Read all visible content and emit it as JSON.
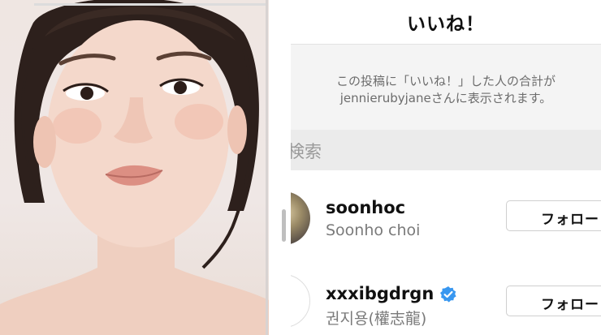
{
  "header": {
    "title": "いいね！"
  },
  "notice": {
    "line1": "この投稿に「いいね！」した人の合計が",
    "line2": "jennierubyjaneさんに表示されます。"
  },
  "search": {
    "placeholder": "検索"
  },
  "likers": [
    {
      "username": "soonhoc",
      "full_name": "Soonho choi",
      "verified": false,
      "button": "フォロー"
    },
    {
      "username": "xxxibgdrgn",
      "full_name": "권지용(權志龍)",
      "verified": true,
      "button": "フォロー"
    }
  ],
  "colors": {
    "verified_badge": "#3897f0",
    "header_text": "#111111",
    "notice_bg": "#f4f4f4",
    "search_bg": "#ebebeb"
  }
}
